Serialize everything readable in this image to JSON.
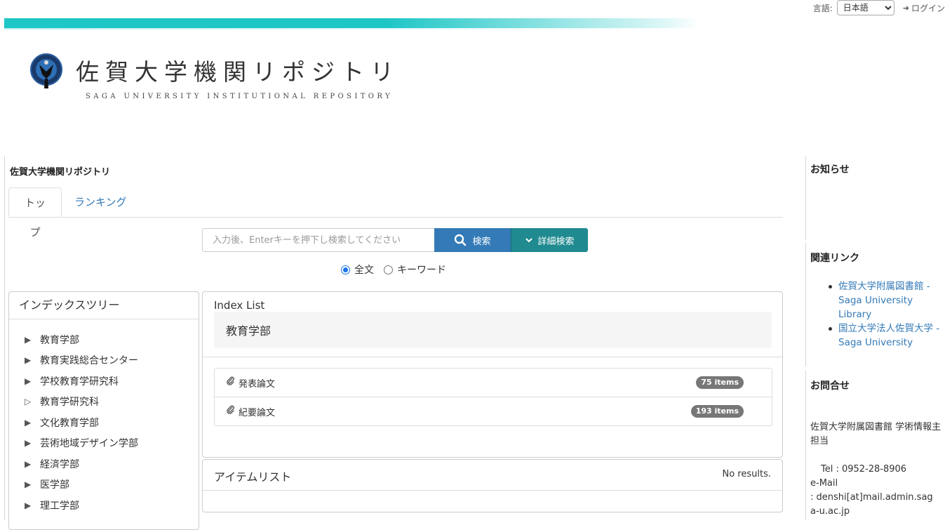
{
  "header": {
    "lang_label": "言語:",
    "lang_selected": "日本語",
    "login_label": "ログイン",
    "logo_title": "佐賀大学機関リポジトリ",
    "logo_subtitle": "SAGA UNIVERSITY INSTITUTIONAL REPOSITORY"
  },
  "main": {
    "title": "佐賀大学機関リポジトリ",
    "tabs": [
      {
        "label": "トップ",
        "active": true
      },
      {
        "label": "ランキング",
        "active": false
      }
    ]
  },
  "search": {
    "placeholder": "入力後、Enterキーを押下し検索してください",
    "search_label": "検索",
    "advanced_label": "詳細検索",
    "radio_fulltext": "全文",
    "radio_keyword": "キーワード"
  },
  "tree": {
    "title": "インデックスツリー",
    "items": [
      {
        "label": "教育学部",
        "arrow": "▶"
      },
      {
        "label": "教育実践総合センター",
        "arrow": "▶"
      },
      {
        "label": "学校教育学研究科",
        "arrow": "▶"
      },
      {
        "label": "教育学研究科",
        "arrow": "▷"
      },
      {
        "label": "文化教育学部",
        "arrow": "▶"
      },
      {
        "label": "芸術地域デザイン学部",
        "arrow": "▶"
      },
      {
        "label": "経済学部",
        "arrow": "▶"
      },
      {
        "label": "医学部",
        "arrow": "▶"
      },
      {
        "label": "理工学部",
        "arrow": "▶"
      }
    ]
  },
  "index": {
    "label": "Index List",
    "heading": "教育学部",
    "rows": [
      {
        "label": "発表論文",
        "count": "75 items"
      },
      {
        "label": "紀要論文",
        "count": "193 items"
      }
    ]
  },
  "items": {
    "title": "アイテムリスト",
    "no_results": "No results."
  },
  "sidebar": {
    "notice_title": "お知らせ",
    "links_title": "関連リンク",
    "links": [
      "佐賀大学附属図書館 - Saga University Library",
      "国立大学法人佐賀大学 - Saga University"
    ],
    "contact_title": "お問合せ",
    "contact_org": "佐賀大学附属図書館 学術情報主担当",
    "contact_tel": "Tel : 0952-28-8906",
    "contact_email_label": "e-Mail",
    "contact_email": ": denshi[at]mail.admin.saga-u.ac.jp"
  },
  "colors": {
    "accent_bar": "#1ec6c6",
    "search_button": "#337ab7",
    "advanced_button": "#1f8a8f",
    "link": "#337ab7",
    "badge": "#777777"
  }
}
